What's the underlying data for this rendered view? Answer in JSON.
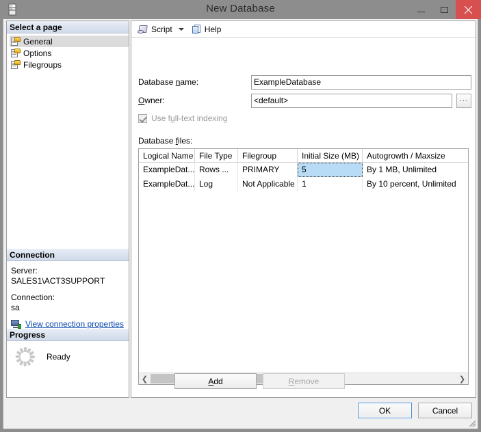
{
  "window": {
    "title": "New Database",
    "icon": "database-icon",
    "controls": {
      "minimize": "minimize-icon",
      "maximize": "maximize-icon",
      "close": "close-icon"
    }
  },
  "sidebar": {
    "header": "Select a page",
    "items": [
      {
        "label": "General",
        "selected": true
      },
      {
        "label": "Options",
        "selected": false
      },
      {
        "label": "Filegroups",
        "selected": false
      }
    ],
    "connection": {
      "header": "Connection",
      "server_label": "Server:",
      "server_value": "SALES1\\ACT3SUPPORT",
      "connection_label": "Connection:",
      "connection_value": "sa",
      "link": "View connection properties"
    },
    "progress": {
      "header": "Progress",
      "status": "Ready",
      "spinner_icon": "loading-spinner-icon"
    }
  },
  "toolbar": {
    "script_label": "Script",
    "script_icon": "script-icon",
    "dropdown_icon": "chevron-down-icon",
    "help_label": "Help",
    "help_icon": "help-icon"
  },
  "form": {
    "database_name": {
      "label_before": "Database ",
      "label_accel": "n",
      "label_after": "ame:",
      "value": "ExampleDatabase"
    },
    "owner": {
      "label_accel": "O",
      "label_after": "wner:",
      "value": "<default>",
      "browse_label": "..."
    },
    "fulltext": {
      "label_before": "Use f",
      "label_accel": "u",
      "label_after": "ll-text indexing",
      "checked": true,
      "enabled": false
    },
    "dbfiles_label_before": "Database ",
    "dbfiles_label_accel": "f",
    "dbfiles_label_after": "iles:"
  },
  "grid": {
    "columns": [
      "Logical Name",
      "File Type",
      "Filegroup",
      "Initial Size (MB)",
      "Autogrowth / Maxsize"
    ],
    "rows": [
      {
        "cells": [
          "ExampleDat...",
          "Rows ...",
          "PRIMARY",
          "5",
          "By 1 MB, Unlimited"
        ],
        "selected_cell_index": 3
      },
      {
        "cells": [
          "ExampleDat...",
          "Log",
          "Not Applicable",
          "1",
          "By 10 percent, Unlimited"
        ],
        "selected_cell_index": -1
      }
    ],
    "scrollbar": {
      "left_arrow": "chevron-left-icon",
      "right_arrow": "chevron-right-icon",
      "thumb_percent": 38
    }
  },
  "buttons": {
    "add": {
      "accel": "A",
      "rest": "dd",
      "enabled": true
    },
    "remove": {
      "accel": "R",
      "rest": "emove",
      "enabled": false
    },
    "ok": "OK",
    "cancel": "Cancel"
  },
  "colors": {
    "titlebar": "#8d8d8d",
    "close_button": "#d84f4f",
    "selection": "#b8dcf5",
    "link": "#0645ad",
    "default_button_border": "#4a90d9"
  }
}
